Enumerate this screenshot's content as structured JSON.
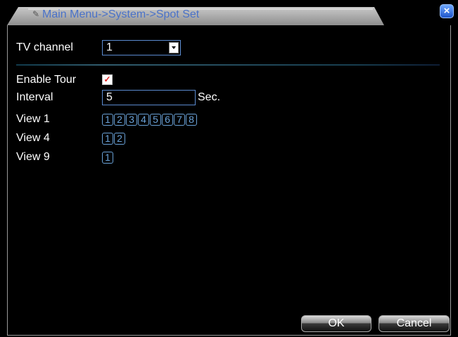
{
  "title": {
    "text": "Main Menu->System->Spot Set",
    "icon": "tools-icon"
  },
  "close_label": "×",
  "tv_channel": {
    "label": "TV channel",
    "value": "1"
  },
  "tour": {
    "label": "Enable Tour",
    "checked": true,
    "check_mark": "✓"
  },
  "interval": {
    "label": "Interval",
    "value": "5",
    "unit": "Sec."
  },
  "views": {
    "view1": {
      "label": "View 1",
      "buttons": [
        "1",
        "2",
        "3",
        "4",
        "5",
        "6",
        "7",
        "8"
      ]
    },
    "view4": {
      "label": "View 4",
      "buttons": [
        "1",
        "2"
      ]
    },
    "view9": {
      "label": "View 9",
      "buttons": [
        "1"
      ]
    }
  },
  "buttons": {
    "ok": "OK",
    "cancel": "Cancel"
  },
  "colors": {
    "accent": "#6aa2d8",
    "title_text": "#4a72c8",
    "background": "#000000"
  }
}
